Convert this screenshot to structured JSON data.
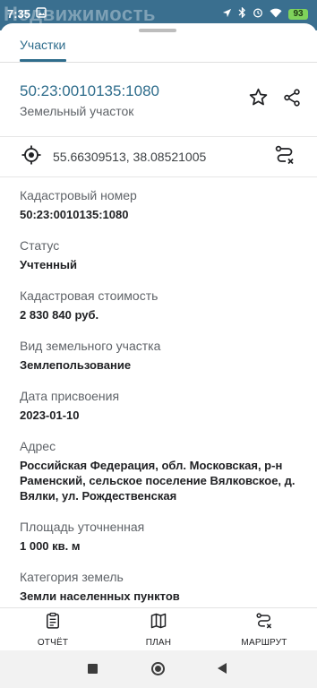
{
  "status_bar": {
    "time": "7:35",
    "battery": "93",
    "background_app_title": "Недвижимость"
  },
  "sheet": {
    "tab_label": "Участки",
    "cadastral_title": "50:23:0010135:1080",
    "object_type": "Земельный участок",
    "coordinates": "55.66309513, 38.08521005"
  },
  "properties": [
    {
      "label": "Кадастровый номер",
      "value": "50:23:0010135:1080"
    },
    {
      "label": "Статус",
      "value": "Учтенный"
    },
    {
      "label": "Кадастровая стоимость",
      "value": "2 830 840 руб."
    },
    {
      "label": "Вид земельного участка",
      "value": "Землепользование"
    },
    {
      "label": "Дата присвоения",
      "value": "2023-01-10"
    },
    {
      "label": "Адрес",
      "value": "Российская Федерация, обл. Московская, р-н Раменский, сельское поселение Вялковское, д. Вялки, ул. Рождественская"
    },
    {
      "label": "Площадь уточненная",
      "value": "1 000 кв. м"
    },
    {
      "label": "Категория земель",
      "value": "Земли населенных пунктов"
    }
  ],
  "bottom_bar": {
    "report_label": "ОТЧЁТ",
    "plan_label": "ПЛАН",
    "route_label": "МАРШРУТ"
  },
  "colors": {
    "accent": "#2f6d8c",
    "status_bar": "#3a6f8f",
    "battery": "#7fd35b"
  },
  "icons": [
    "star-icon",
    "share-icon",
    "crosshair-icon",
    "route-icon",
    "report-icon",
    "map-icon"
  ]
}
